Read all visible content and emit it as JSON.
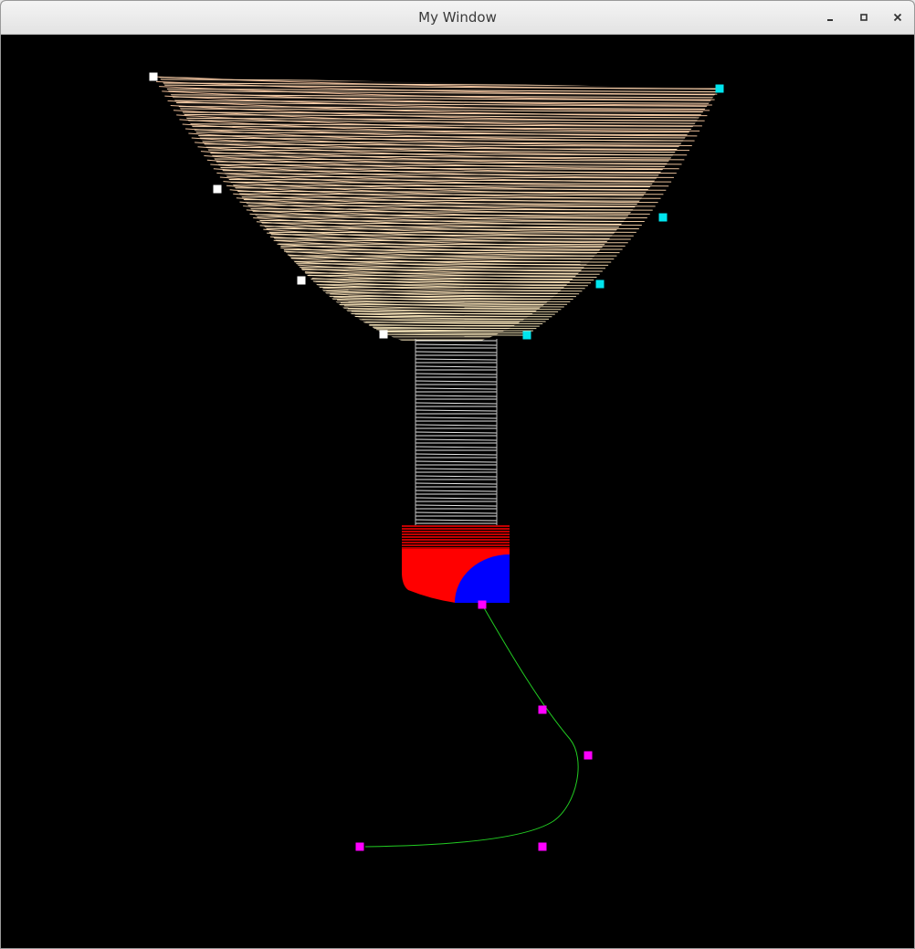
{
  "window": {
    "title": "My Window",
    "controls": [
      "minimize",
      "maximize",
      "close"
    ]
  },
  "scene": {
    "background_color": "#000000",
    "bowl": {
      "color": "#ffd2b8",
      "left_handle_color": "#ffffff",
      "right_handle_color": "#00e5ee"
    },
    "stem": {
      "color": "#e6e6e6"
    },
    "base": {
      "red_color": "#ff0000",
      "blue_color": "#0000ff"
    },
    "curve": {
      "color": "#22cc22",
      "handle_color": "#ff00ff"
    }
  }
}
